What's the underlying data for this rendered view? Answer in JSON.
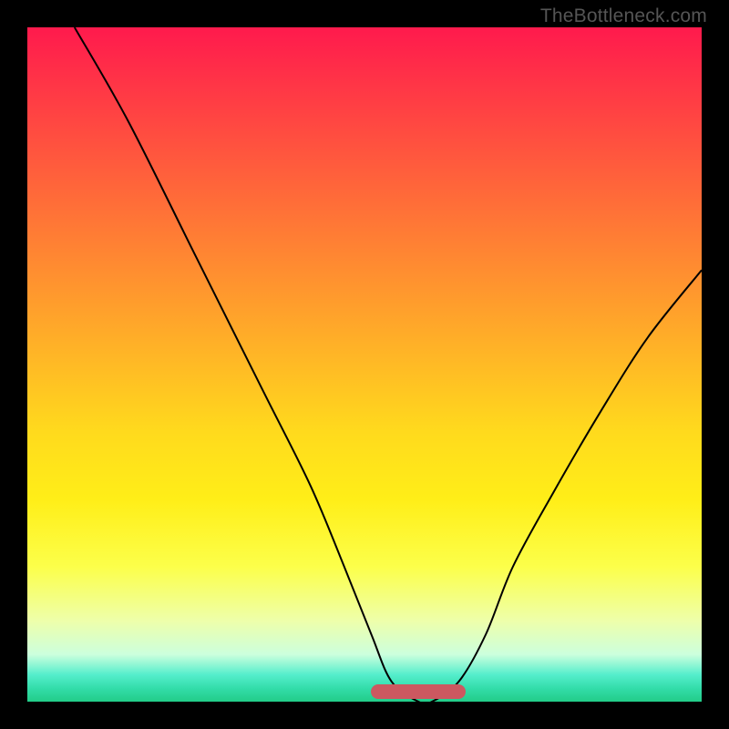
{
  "watermark": "TheBottleneck.com",
  "chart_data": {
    "type": "line",
    "title": "",
    "xlabel": "",
    "ylabel": "",
    "xlim": [
      0,
      100
    ],
    "ylim": [
      0,
      100
    ],
    "series": [
      {
        "name": "bottleneck-curve",
        "x": [
          7,
          15,
          25,
          35,
          42,
          47,
          51,
          54,
          58,
          60,
          64,
          68,
          72,
          78,
          85,
          92,
          100
        ],
        "y": [
          100,
          86,
          66,
          46,
          32,
          20,
          10,
          3,
          0,
          0,
          3,
          10,
          20,
          31,
          43,
          54,
          64
        ]
      }
    ],
    "accent_band": {
      "x_start": 51,
      "x_end": 65,
      "y": 1.5
    },
    "background_gradient": {
      "top": "#ff1a4d",
      "mid": "#ffee18",
      "bottom": "#22cc88"
    },
    "accent_color": "#cc5860"
  }
}
